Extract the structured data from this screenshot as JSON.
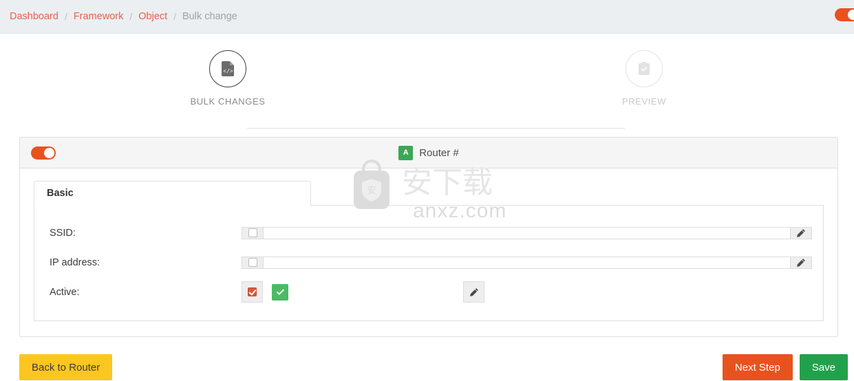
{
  "breadcrumb": {
    "items": [
      {
        "label": "Dashboard",
        "active": true
      },
      {
        "label": "Framework",
        "active": true
      },
      {
        "label": "Object",
        "active": true
      },
      {
        "label": "Bulk change",
        "active": false
      }
    ],
    "separator": "/"
  },
  "header": {
    "toggle": {
      "name": "top-right-toggle",
      "state": "on",
      "color": "#e8521f"
    }
  },
  "stepper": {
    "steps": [
      {
        "label": "BULK CHANGES",
        "icon": "file-code-icon",
        "state": "active"
      },
      {
        "label": "PREVIEW",
        "icon": "clipboard-check-icon",
        "state": "inactive"
      }
    ]
  },
  "panel": {
    "toggle": {
      "name": "panel-enable-toggle",
      "state": "on",
      "color": "#e8521f"
    },
    "badge_letter": "A",
    "title": "Router #"
  },
  "tabs": [
    {
      "label": "Basic",
      "active": true
    }
  ],
  "form": {
    "rows": [
      {
        "label": "SSID:",
        "checkbox_checked": false,
        "value": "",
        "placeholder": "",
        "edit_icon": "pencil-icon"
      },
      {
        "label": "IP address:",
        "checkbox_checked": false,
        "value": "",
        "placeholder": "",
        "edit_icon": "pencil-icon"
      },
      {
        "label": "Active:",
        "checkbox_checked": true,
        "value": "",
        "placeholder": "",
        "edit_icon": "pencil-icon",
        "has_green_check": true
      }
    ]
  },
  "footer": {
    "back_label": "Back to Router",
    "next_label": "Next Step",
    "save_label": "Save"
  },
  "watermark": {
    "text": "anxz.com",
    "glyph": "安"
  },
  "colors": {
    "accent_orange": "#e8521f",
    "breadcrumb_link": "#e8604c",
    "badge_green": "#3aa757",
    "button_yellow": "#fcc620",
    "button_green": "#22a14c",
    "checkbox_orange": "#d9583a",
    "check_green": "#4cbb63"
  }
}
